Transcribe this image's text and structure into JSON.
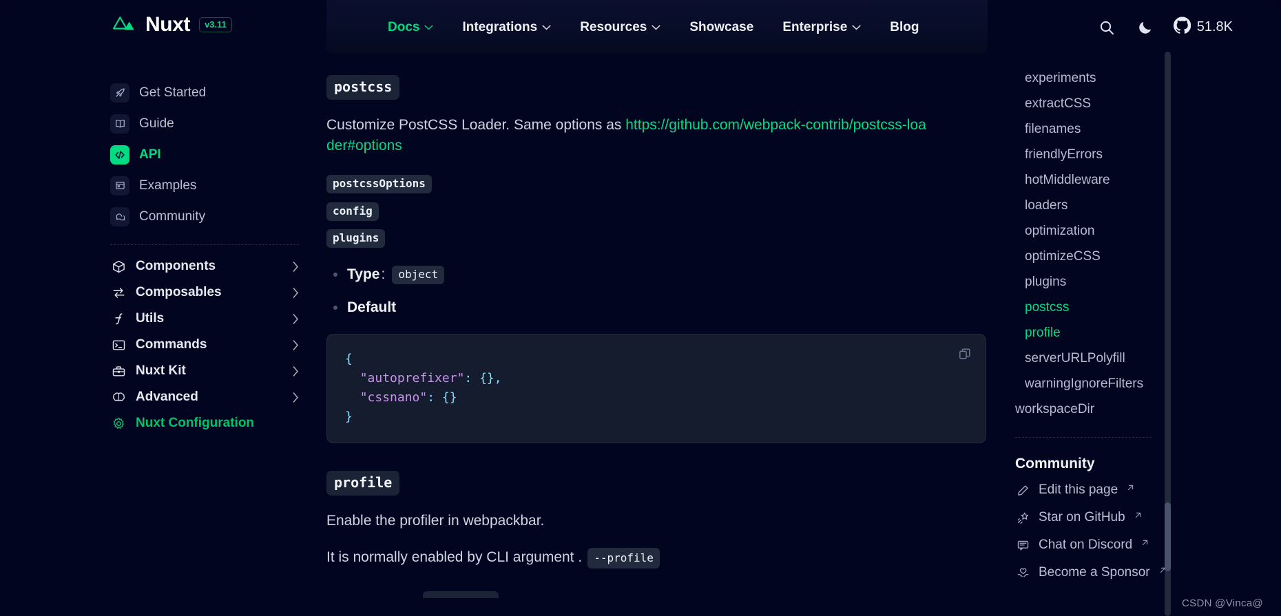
{
  "header": {
    "brand": {
      "name": "Nuxt",
      "version": "v3.11",
      "logo_icon": "nuxt-logo-icon"
    },
    "nav": [
      {
        "label": "Docs",
        "has_chevron": true,
        "active": true
      },
      {
        "label": "Integrations",
        "has_chevron": true,
        "active": false
      },
      {
        "label": "Resources",
        "has_chevron": true,
        "active": false
      },
      {
        "label": "Showcase",
        "has_chevron": false,
        "active": false
      },
      {
        "label": "Enterprise",
        "has_chevron": true,
        "active": false
      },
      {
        "label": "Blog",
        "has_chevron": false,
        "active": false
      }
    ],
    "actions": {
      "search_icon": "search-icon",
      "theme_icon": "moon-icon",
      "github_icon": "github-icon",
      "github_stars": "51.8K"
    }
  },
  "sidebar": {
    "primary": [
      {
        "label": "Get Started",
        "icon": "rocket-icon",
        "active": false
      },
      {
        "label": "Guide",
        "icon": "book-icon",
        "active": false
      },
      {
        "label": "API",
        "icon": "code-brackets-icon",
        "active": true
      },
      {
        "label": "Examples",
        "icon": "window-icon",
        "active": false
      },
      {
        "label": "Community",
        "icon": "chat-icon",
        "active": false
      }
    ],
    "groups": [
      {
        "label": "Components",
        "icon": "cube-icon",
        "active": false
      },
      {
        "label": "Composables",
        "icon": "arrows-swap-icon",
        "active": false
      },
      {
        "label": "Utils",
        "icon": "function-icon",
        "active": false
      },
      {
        "label": "Commands",
        "icon": "terminal-icon",
        "active": false
      },
      {
        "label": "Nuxt Kit",
        "icon": "toolbox-icon",
        "active": false
      },
      {
        "label": "Advanced",
        "icon": "brain-icon",
        "active": false
      },
      {
        "label": "Nuxt Configuration",
        "icon": "gear-icon",
        "active": true
      }
    ]
  },
  "main": {
    "postcss": {
      "heading": "postcss",
      "description_prefix": "Customize PostCSS Loader. Same options as ",
      "link_text": "https://github.com/webpack-contrib/postcss-loader#options",
      "sub_chips": [
        "postcssOptions",
        "config",
        "plugins"
      ],
      "bullets": {
        "type_label": "Type",
        "type_sep": ":",
        "type_value": "object",
        "default_label": "Default"
      },
      "code": {
        "language": "json",
        "copy_icon": "copy-icon",
        "lines": [
          "{",
          "  \"autoprefixer\": {},",
          "  \"cssnano\": {}",
          "}"
        ]
      }
    },
    "profile": {
      "heading": "profile",
      "description": "Enable the profiler in webpackbar.",
      "note_prefix": "It is normally enabled by CLI argument ",
      "note_chip": "--profile",
      "note_suffix": "."
    }
  },
  "toc": {
    "items": [
      {
        "label": "experiments",
        "level": "sub",
        "active": false
      },
      {
        "label": "extractCSS",
        "level": "sub",
        "active": false
      },
      {
        "label": "filenames",
        "level": "sub",
        "active": false
      },
      {
        "label": "friendlyErrors",
        "level": "sub",
        "active": false
      },
      {
        "label": "hotMiddleware",
        "level": "sub",
        "active": false
      },
      {
        "label": "loaders",
        "level": "sub",
        "active": false
      },
      {
        "label": "optimization",
        "level": "sub",
        "active": false
      },
      {
        "label": "optimizeCSS",
        "level": "sub",
        "active": false
      },
      {
        "label": "plugins",
        "level": "sub",
        "active": false
      },
      {
        "label": "postcss",
        "level": "sub",
        "active": true
      },
      {
        "label": "profile",
        "level": "sub",
        "active": true
      },
      {
        "label": "serverURLPolyfill",
        "level": "sub",
        "active": false
      },
      {
        "label": "warningIgnoreFilters",
        "level": "sub",
        "active": false
      },
      {
        "label": "workspaceDir",
        "level": "top",
        "active": false
      }
    ],
    "community": {
      "title": "Community",
      "links": [
        {
          "label": "Edit this page",
          "icon": "pencil-icon",
          "external": true
        },
        {
          "label": "Star on GitHub",
          "icon": "shooting-star-icon",
          "external": true
        },
        {
          "label": "Chat on Discord",
          "icon": "message-icon",
          "external": true
        },
        {
          "label": "Become a Sponsor",
          "icon": "heart-hands-icon",
          "external": true
        }
      ]
    }
  },
  "watermark": "CSDN @Vinca@",
  "colors": {
    "accent": "#00dc82",
    "background": "#020520",
    "panel": "#141c2e",
    "chip": "#1b2337",
    "text": "#cfd4e4",
    "muted": "#b5bcd2"
  }
}
